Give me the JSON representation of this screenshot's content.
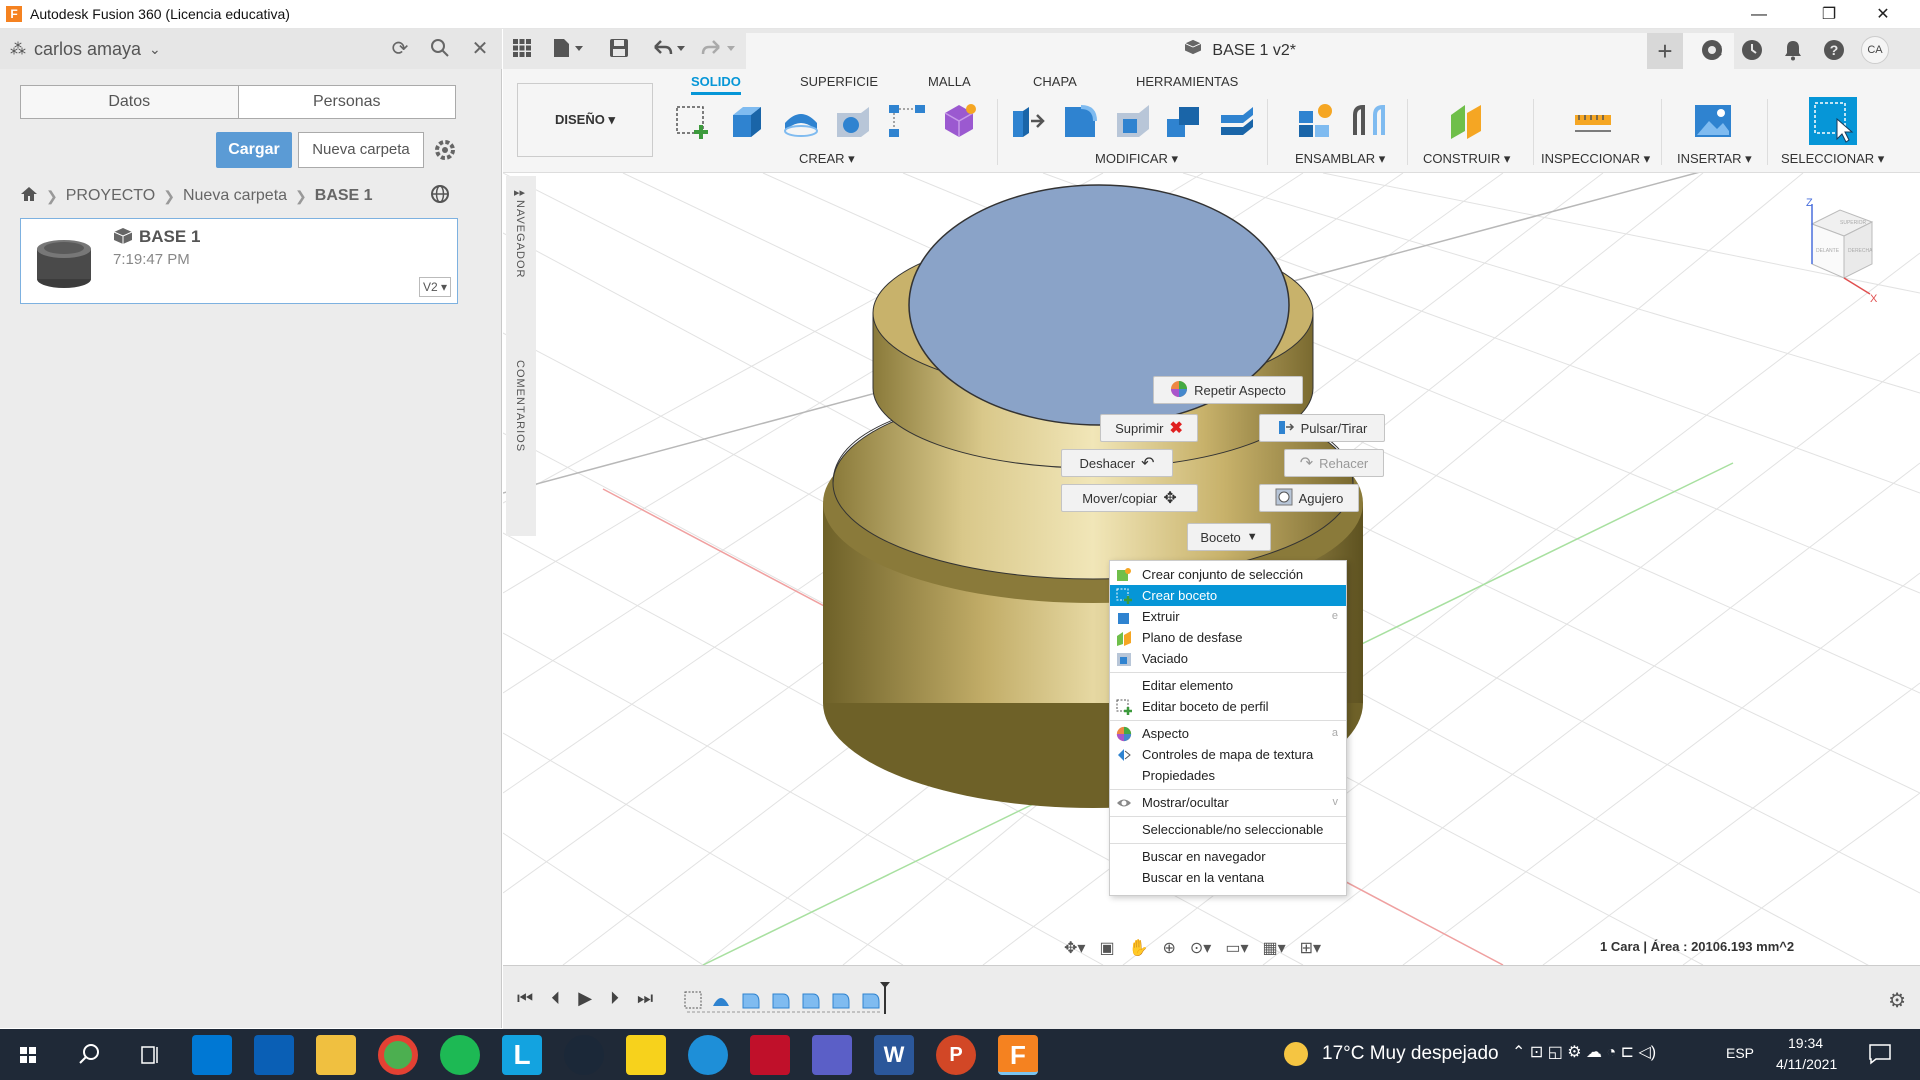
{
  "window": {
    "title": "Autodesk Fusion 360 (Licencia educativa)",
    "minimize": "—",
    "restore": "❐",
    "close": "✕"
  },
  "datapanel": {
    "user": "carlos amaya",
    "tabs": [
      "Datos",
      "Personas"
    ],
    "upload_label": "Cargar",
    "new_folder_label": "Nueva carpeta",
    "breadcrumb": [
      "PROYECTO",
      "Nueva carpeta",
      "BASE 1"
    ],
    "file": {
      "name": "BASE 1",
      "time": "7:19:47 PM",
      "version": "V2 ▾"
    }
  },
  "document": {
    "tab_title": "BASE 1 v2*",
    "avatar": "CA"
  },
  "ribbon": {
    "workspace": "DISEÑO ▾",
    "tabs": [
      "SOLIDO",
      "SUPERFICIE",
      "MALLA",
      "CHAPA",
      "HERRAMIENTAS"
    ],
    "active_tab": "SOLIDO",
    "groups": [
      "CREAR ▾",
      "MODIFICAR ▾",
      "ENSAMBLAR ▾",
      "CONSTRUIR ▾",
      "INSPECCIONAR ▾",
      "INSERTAR ▾",
      "SELECCIONAR ▾"
    ]
  },
  "side": {
    "navigator": "NAVEGADOR",
    "comments": "COMENTARIOS"
  },
  "marking_menu": {
    "repeat": "Repetir Aspecto",
    "suppress": "Suprimir",
    "pushpull": "Pulsar/Tirar",
    "undo": "Deshacer",
    "redo": "Rehacer",
    "move": "Mover/copiar",
    "hole": "Agujero",
    "sketch": "Boceto"
  },
  "context_menu": {
    "items": [
      {
        "label": "Crear conjunto de selección",
        "shortcut": ""
      },
      {
        "label": "Crear boceto",
        "shortcut": ""
      },
      {
        "label": "Extruir",
        "shortcut": "e"
      },
      {
        "label": "Plano de desfase",
        "shortcut": ""
      },
      {
        "label": "Vaciado",
        "shortcut": ""
      },
      {
        "label": "Editar elemento",
        "shortcut": ""
      },
      {
        "label": "Editar boceto de perfil",
        "shortcut": ""
      },
      {
        "label": "Aspecto",
        "shortcut": "a"
      },
      {
        "label": "Controles de mapa de textura",
        "shortcut": ""
      },
      {
        "label": "Propiedades",
        "shortcut": ""
      },
      {
        "label": "Mostrar/ocultar",
        "shortcut": "v"
      },
      {
        "label": "Seleccionable/no seleccionable",
        "shortcut": ""
      },
      {
        "label": "Buscar en navegador",
        "shortcut": ""
      },
      {
        "label": "Buscar en la ventana",
        "shortcut": ""
      }
    ],
    "selected": "Crear boceto"
  },
  "status": {
    "selection": "1 Cara | Área : 20106.193 mm^2"
  },
  "viewcube": {
    "axis_z": "Z",
    "axis_x": "X",
    "face_top": "SUPERIOR",
    "face_front": "DELANTE",
    "face_right": "DERECHA"
  },
  "taskbar": {
    "weather": "17°C  Muy despejado",
    "lang": "ESP",
    "time": "19:34",
    "date": "4/11/2021"
  },
  "colors": {
    "accent": "#0696d7",
    "highlight": "#0696d7",
    "face": "#8aa3c8",
    "gold": "#c8b26b"
  }
}
